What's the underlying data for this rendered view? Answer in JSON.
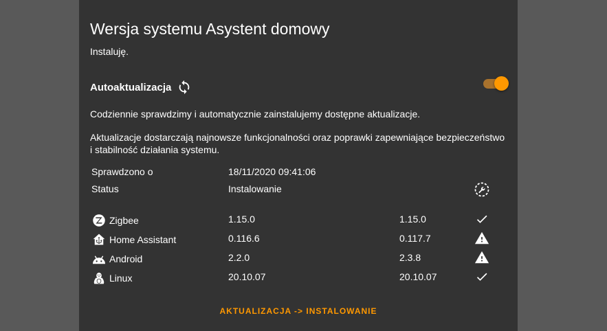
{
  "card": {
    "title": "Wersja systemu Asystent domowy",
    "subtitle": "Instaluję."
  },
  "autoupdate": {
    "title": "Autoaktualizacja",
    "icon": "sync-icon",
    "toggle_on": true,
    "accent_color": "#ff9800",
    "description1": "Codziennie sprawdzimy i automatycznie zainstalujemy dostępne aktualizacje.",
    "description2": "Aktualizacje dostarczają najnowsze funkcjonalności oraz poprawki zapewniające bezpieczeństwo i stabilność działania systemu."
  },
  "info": {
    "checked_label": "Sprawdzono o",
    "checked_value": "18/11/2020 09:41:06",
    "status_label": "Status",
    "status_value": "Instalowanie",
    "status_icon": "progress-wrench-icon"
  },
  "components": [
    {
      "name": "Zigbee",
      "icon": "zigbee-icon",
      "current": "1.15.0",
      "latest": "1.15.0",
      "state_icon": "check-icon"
    },
    {
      "name": "Home Assistant",
      "icon": "home-assistant-icon",
      "current": "0.116.6",
      "latest": "0.117.7",
      "state_icon": "alert-icon"
    },
    {
      "name": "Android",
      "icon": "android-icon",
      "current": "2.2.0",
      "latest": "2.3.8",
      "state_icon": "alert-icon"
    },
    {
      "name": "Linux",
      "icon": "linux-icon",
      "current": "20.10.07",
      "latest": "20.10.07",
      "state_icon": "check-icon"
    }
  ],
  "action_label": "AKTUALIZACJA -> INSTALOWANIE"
}
